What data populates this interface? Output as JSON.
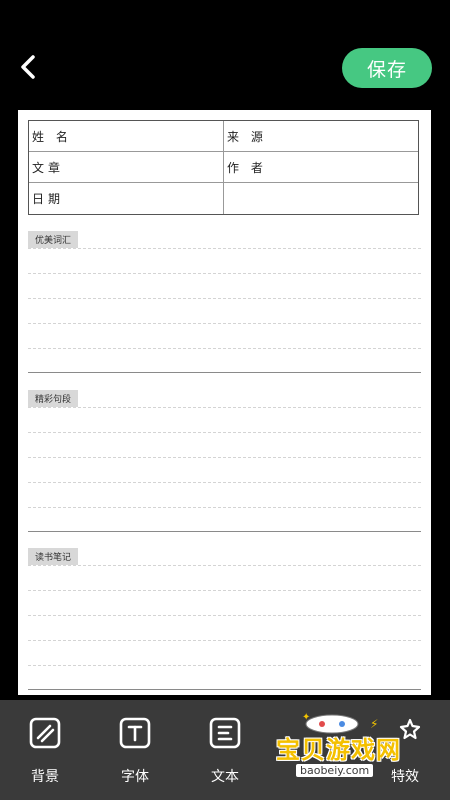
{
  "header": {
    "back_icon": "chevron-left-icon",
    "save_label": "保存",
    "save_color": "#46c882"
  },
  "sheet": {
    "table": {
      "name_label": "姓 名",
      "source_label": "来 源",
      "article_label": "文章",
      "author_label": "作 者",
      "date_label": "日期"
    },
    "sections": [
      {
        "title": "优美词汇"
      },
      {
        "title": "精彩句段"
      },
      {
        "title": "读书笔记"
      }
    ]
  },
  "toolbar": {
    "items": [
      {
        "label": "背景",
        "icon": "background-pattern-icon"
      },
      {
        "label": "字体",
        "icon": "font-t-icon"
      },
      {
        "label": "文本",
        "icon": "text-align-icon"
      },
      {
        "label": "特效",
        "icon": "sparkle-effects-icon"
      }
    ]
  },
  "watermark": {
    "text": "宝贝游戏网",
    "url": "baobeiy.com"
  }
}
